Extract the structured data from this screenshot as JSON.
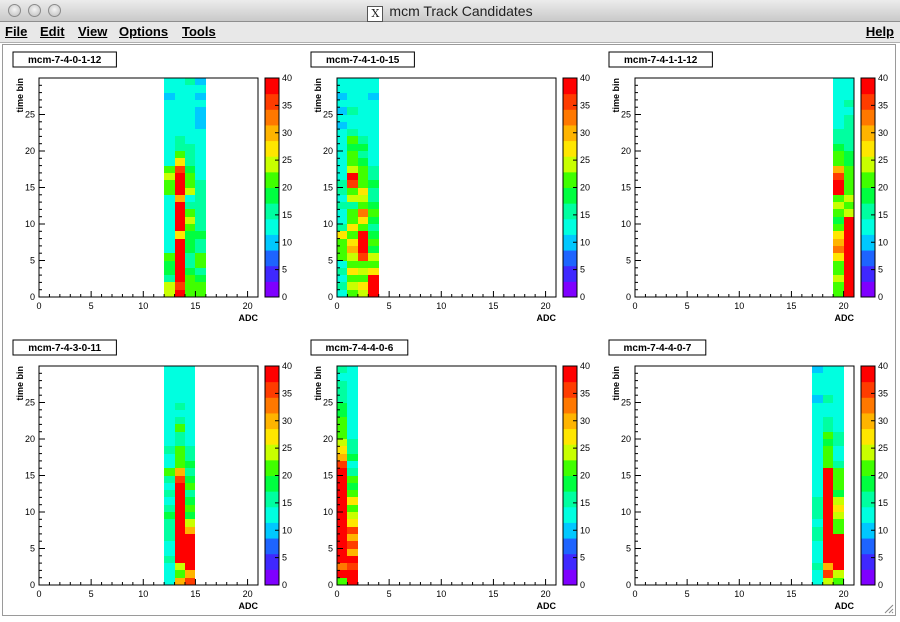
{
  "window": {
    "title": "mcm Track Candidates"
  },
  "menu": {
    "file": "File",
    "edit": "Edit",
    "view": "View",
    "options": "Options",
    "tools": "Tools",
    "help": "Help"
  },
  "chart_data": [
    {
      "type": "heatmap",
      "title": "mcm-7-4-0-1-12",
      "xlabel": "ADC",
      "ylabel": "time bin",
      "xlim": [
        0,
        21
      ],
      "ylim": [
        0,
        30
      ],
      "zlim": [
        0,
        40
      ],
      "x_ticks": [
        0,
        5,
        10,
        15,
        20
      ],
      "y_ticks": [
        0,
        5,
        10,
        15,
        20,
        25
      ],
      "z_ticks": [
        0,
        5,
        10,
        15,
        20,
        25,
        30,
        35,
        40
      ],
      "x_tick_labels": [
        "0",
        "5",
        "10",
        "15",
        "20"
      ],
      "y_tick_labels": [
        "0",
        "5",
        "10",
        "15",
        "20",
        "25"
      ],
      "z_tick_labels": [
        "0",
        "5",
        "10",
        "15",
        "20",
        "25",
        "30",
        "35",
        "40"
      ],
      "columns": [
        {
          "x": 12,
          "values": [
            24,
            24,
            16,
            18,
            19,
            20,
            12,
            12,
            14,
            13,
            12,
            12,
            14,
            13,
            20,
            22,
            23,
            22,
            14,
            13,
            13,
            14,
            12,
            12,
            12,
            13,
            12,
            11,
            12,
            13
          ]
        },
        {
          "x": 13,
          "values": [
            40,
            35,
            39,
            40,
            40,
            40,
            40,
            38,
            26,
            40,
            40,
            40,
            40,
            30,
            40,
            40,
            40,
            36,
            26,
            22,
            16,
            16,
            14,
            14,
            14,
            13,
            14,
            14,
            14,
            14
          ]
        },
        {
          "x": 14,
          "values": [
            22,
            22,
            22,
            18,
            17,
            17,
            18,
            18,
            18,
            22,
            24,
            22,
            17,
            14,
            24,
            22,
            22,
            18,
            17,
            17,
            15,
            14,
            14,
            14,
            13,
            13,
            13,
            14,
            14,
            15
          ]
        },
        {
          "x": 15,
          "values": [
            20,
            22,
            19,
            17,
            20,
            20,
            16,
            17,
            18,
            15,
            17,
            17,
            16,
            15,
            16,
            16,
            14,
            14,
            14,
            13,
            13,
            13,
            12,
            11,
            10,
            10,
            12,
            10,
            12,
            11
          ]
        }
      ]
    },
    {
      "type": "heatmap",
      "title": "mcm-7-4-1-0-15",
      "xlabel": "ADC",
      "ylabel": "time bin",
      "xlim": [
        0,
        21
      ],
      "ylim": [
        0,
        30
      ],
      "zlim": [
        0,
        40
      ],
      "x_ticks": [
        0,
        5,
        10,
        15,
        20
      ],
      "y_ticks": [
        0,
        5,
        10,
        15,
        20,
        25
      ],
      "z_ticks": [
        0,
        5,
        10,
        15,
        20,
        25,
        30,
        35,
        40
      ],
      "x_tick_labels": [
        "0",
        "5",
        "10",
        "15",
        "20"
      ],
      "y_tick_labels": [
        "0",
        "5",
        "10",
        "15",
        "20",
        "25"
      ],
      "z_tick_labels": [
        "0",
        "5",
        "10",
        "15",
        "20",
        "25",
        "30",
        "35",
        "40"
      ],
      "columns": [
        {
          "x": 0,
          "values": [
            14,
            15,
            14,
            16,
            14,
            20,
            22,
            20,
            26,
            17,
            14,
            14,
            16,
            14,
            16,
            15,
            12,
            12,
            13,
            12,
            13,
            13,
            12,
            11,
            12,
            11,
            12,
            11,
            12,
            12
          ]
        },
        {
          "x": 1,
          "values": [
            20,
            24,
            22,
            26,
            22,
            24,
            30,
            26,
            22,
            26,
            22,
            20,
            16,
            24,
            22,
            36,
            38,
            24,
            22,
            20,
            19,
            20,
            16,
            14,
            14,
            15,
            14,
            12,
            14,
            13
          ]
        },
        {
          "x": 2,
          "values": [
            24,
            26,
            22,
            24,
            22,
            36,
            40,
            40,
            38,
            22,
            28,
            32,
            22,
            24,
            26,
            22,
            20,
            22,
            18,
            16,
            18,
            16,
            14,
            14,
            14,
            13,
            14,
            12,
            13,
            13
          ]
        },
        {
          "x": 3,
          "values": [
            40,
            40,
            38,
            26,
            20,
            24,
            18,
            20,
            18,
            16,
            18,
            20,
            18,
            16,
            16,
            18,
            16,
            16,
            14,
            14,
            13,
            14,
            14,
            12,
            13,
            12,
            12,
            11,
            13,
            12
          ]
        }
      ]
    },
    {
      "type": "heatmap",
      "title": "mcm-7-4-1-1-12",
      "xlabel": "ADC",
      "ylabel": "time bin",
      "xlim": [
        0,
        21
      ],
      "ylim": [
        0,
        30
      ],
      "zlim": [
        0,
        40
      ],
      "x_ticks": [
        0,
        5,
        10,
        15,
        20
      ],
      "y_ticks": [
        0,
        5,
        10,
        15,
        20,
        25
      ],
      "z_ticks": [
        0,
        5,
        10,
        15,
        20,
        25,
        30,
        35,
        40
      ],
      "x_tick_labels": [
        "0",
        "5",
        "10",
        "15",
        "20"
      ],
      "y_tick_labels": [
        "0",
        "5",
        "10",
        "15",
        "20",
        "25"
      ],
      "z_tick_labels": [
        "0",
        "5",
        "10",
        "15",
        "20",
        "25",
        "30",
        "35",
        "40"
      ],
      "columns": [
        {
          "x": 19,
          "values": [
            22,
            20,
            24,
            20,
            22,
            26,
            34,
            30,
            26,
            20,
            18,
            22,
            24,
            22,
            38,
            38,
            36,
            30,
            22,
            20,
            18,
            17,
            16,
            14,
            14,
            12,
            13,
            12,
            13,
            14
          ]
        },
        {
          "x": 20,
          "values": [
            40,
            40,
            40,
            40,
            40,
            40,
            40,
            40,
            40,
            40,
            40,
            24,
            22,
            24,
            20,
            22,
            22,
            20,
            18,
            18,
            16,
            17,
            16,
            16,
            15,
            14,
            15,
            14,
            14,
            14
          ]
        }
      ]
    },
    {
      "type": "heatmap",
      "title": "mcm-7-4-3-0-11",
      "xlabel": "ADC",
      "ylabel": "time bin",
      "xlim": [
        0,
        21
      ],
      "ylim": [
        0,
        30
      ],
      "zlim": [
        0,
        40
      ],
      "x_ticks": [
        0,
        5,
        10,
        15,
        20
      ],
      "y_ticks": [
        0,
        5,
        10,
        15,
        20,
        25
      ],
      "z_ticks": [
        0,
        5,
        10,
        15,
        20,
        25,
        30,
        35,
        40
      ],
      "x_tick_labels": [
        "0",
        "5",
        "10",
        "15",
        "20"
      ],
      "y_tick_labels": [
        "0",
        "5",
        "10",
        "15",
        "20",
        "25"
      ],
      "z_tick_labels": [
        "0",
        "5",
        "10",
        "15",
        "20",
        "25",
        "30",
        "35",
        "40"
      ],
      "columns": [
        {
          "x": 12,
          "values": [
            12,
            12,
            14,
            16,
            14,
            13,
            15,
            16,
            17,
            18,
            16,
            14,
            15,
            13,
            15,
            20,
            14,
            13,
            15,
            14,
            13,
            14,
            13,
            12,
            14,
            13,
            14,
            12,
            13,
            13
          ]
        },
        {
          "x": 13,
          "values": [
            30,
            22,
            24,
            40,
            40,
            40,
            40,
            40,
            40,
            40,
            40,
            40,
            40,
            38,
            36,
            30,
            22,
            22,
            20,
            16,
            16,
            22,
            16,
            14,
            16,
            14,
            14,
            13,
            14,
            13
          ]
        },
        {
          "x": 14,
          "values": [
            36,
            30,
            40,
            40,
            40,
            40,
            40,
            30,
            24,
            18,
            20,
            18,
            16,
            22,
            18,
            16,
            18,
            16,
            15,
            14,
            14,
            13,
            14,
            13,
            12,
            13,
            12,
            13,
            14,
            14
          ]
        }
      ]
    },
    {
      "type": "heatmap",
      "title": "mcm-7-4-4-0-6",
      "xlabel": "ADC",
      "ylabel": "time bin",
      "xlim": [
        0,
        21
      ],
      "ylim": [
        0,
        30
      ],
      "zlim": [
        0,
        40
      ],
      "x_ticks": [
        0,
        5,
        10,
        15,
        20
      ],
      "y_ticks": [
        0,
        5,
        10,
        15,
        20,
        25
      ],
      "z_ticks": [
        0,
        5,
        10,
        15,
        20,
        25,
        30,
        35,
        40
      ],
      "x_tick_labels": [
        "0",
        "5",
        "10",
        "15",
        "20"
      ],
      "y_tick_labels": [
        "0",
        "5",
        "10",
        "15",
        "20",
        "25"
      ],
      "z_tick_labels": [
        "0",
        "5",
        "10",
        "15",
        "20",
        "25",
        "30",
        "35",
        "40"
      ],
      "columns": [
        {
          "x": 0,
          "values": [
            20,
            40,
            34,
            40,
            40,
            40,
            40,
            40,
            40,
            40,
            40,
            40,
            40,
            40,
            40,
            40,
            36,
            30,
            26,
            24,
            22,
            20,
            20,
            18,
            18,
            16,
            16,
            15,
            14,
            15
          ]
        },
        {
          "x": 1,
          "values": [
            40,
            40,
            36,
            40,
            30,
            36,
            30,
            36,
            26,
            24,
            22,
            26,
            20,
            18,
            22,
            16,
            14,
            18,
            16,
            16,
            14,
            14,
            13,
            12,
            12,
            12,
            12,
            13,
            12,
            12
          ]
        }
      ]
    },
    {
      "type": "heatmap",
      "title": "mcm-7-4-4-0-7",
      "xlabel": "ADC",
      "ylabel": "time bin",
      "xlim": [
        0,
        21
      ],
      "ylim": [
        0,
        30
      ],
      "zlim": [
        0,
        40
      ],
      "x_ticks": [
        0,
        5,
        10,
        15,
        20
      ],
      "y_ticks": [
        0,
        5,
        10,
        15,
        20,
        25
      ],
      "z_ticks": [
        0,
        5,
        10,
        15,
        20,
        25,
        30,
        35,
        40
      ],
      "x_tick_labels": [
        "0",
        "5",
        "10",
        "15",
        "20"
      ],
      "y_tick_labels": [
        "0",
        "5",
        "10",
        "15",
        "20",
        "25"
      ],
      "z_tick_labels": [
        "0",
        "5",
        "10",
        "15",
        "20",
        "25",
        "30",
        "35",
        "40"
      ],
      "columns": [
        {
          "x": 17,
          "values": [
            12,
            14,
            16,
            13,
            12,
            14,
            16,
            16,
            14,
            16,
            17,
            16,
            14,
            14,
            12,
            13,
            14,
            12,
            13,
            14,
            14,
            12,
            13,
            14,
            12,
            11,
            12,
            13,
            12,
            10
          ]
        },
        {
          "x": 18,
          "values": [
            24,
            36,
            30,
            40,
            40,
            40,
            40,
            40,
            40,
            40,
            40,
            40,
            40,
            40,
            40,
            38,
            22,
            20,
            22,
            18,
            20,
            16,
            16,
            14,
            14,
            15,
            14,
            13,
            14,
            14
          ]
        },
        {
          "x": 19,
          "values": [
            20,
            24,
            40,
            40,
            40,
            40,
            40,
            22,
            20,
            24,
            26,
            24,
            18,
            22,
            20,
            22,
            16,
            14,
            14,
            16,
            16,
            14,
            13,
            13,
            14,
            13,
            12,
            12,
            13,
            13
          ]
        }
      ]
    }
  ]
}
